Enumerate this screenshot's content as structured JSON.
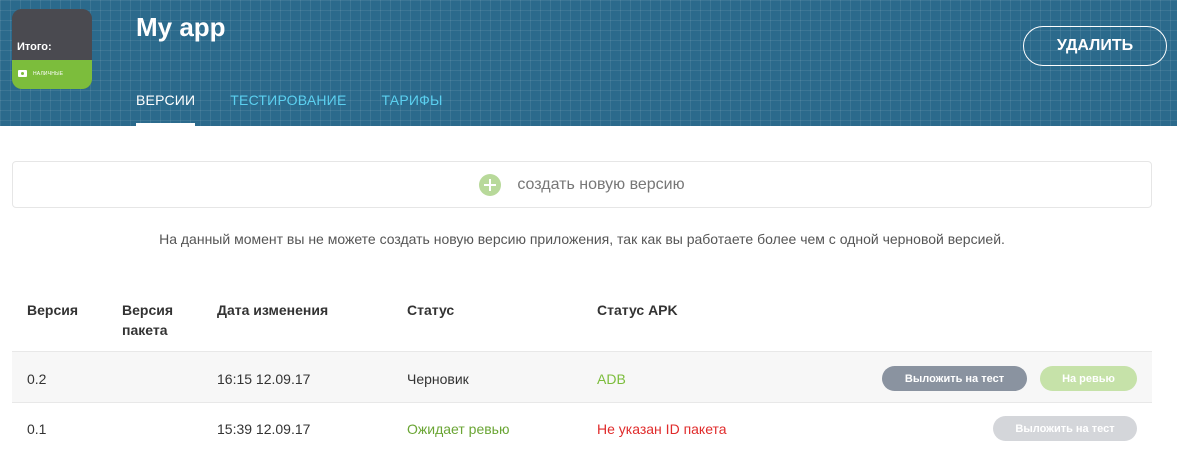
{
  "header": {
    "app_title": "My app",
    "icon_text": "Итого:",
    "icon_cash_label": "НАЛИЧНЫЕ",
    "delete_label": "УДАЛИТЬ",
    "tabs": [
      {
        "label": "ВЕРСИИ",
        "active": true
      },
      {
        "label": "ТЕСТИРОВАНИЕ",
        "active": false
      },
      {
        "label": "ТАРИФЫ",
        "active": false
      }
    ]
  },
  "create": {
    "label": "создать новую версию"
  },
  "notice": "На данный момент вы не можете создать новую версию приложения, так как вы работаете более чем с одной черновой версией.",
  "table": {
    "headers": {
      "version": "Версия",
      "package_version_line1": "Версия",
      "package_version_line2": "пакета",
      "modified": "Дата изменения",
      "status": "Статус",
      "apk_status": "Статус APK"
    },
    "rows": [
      {
        "version": "0.2",
        "package_version": "",
        "modified": "16:15 12.09.17",
        "status": "Черновик",
        "apk_status": "ADB",
        "publish_test_label": "Выложить на тест",
        "review_label": "На ревью"
      },
      {
        "version": "0.1",
        "package_version": "",
        "modified": "15:39 12.09.17",
        "status": "Ожидает ревью",
        "apk_status": "Не указан ID пакета",
        "publish_test_label": "Выложить на тест"
      }
    ]
  },
  "colors": {
    "header_bg": "#2b6a8c",
    "tab_inactive": "#5bd0f0",
    "accent_green": "#7cbd3c",
    "error_red": "#e02b2b"
  },
  "icons": {
    "create": "plus-circle-icon",
    "cash": "cash-icon"
  }
}
